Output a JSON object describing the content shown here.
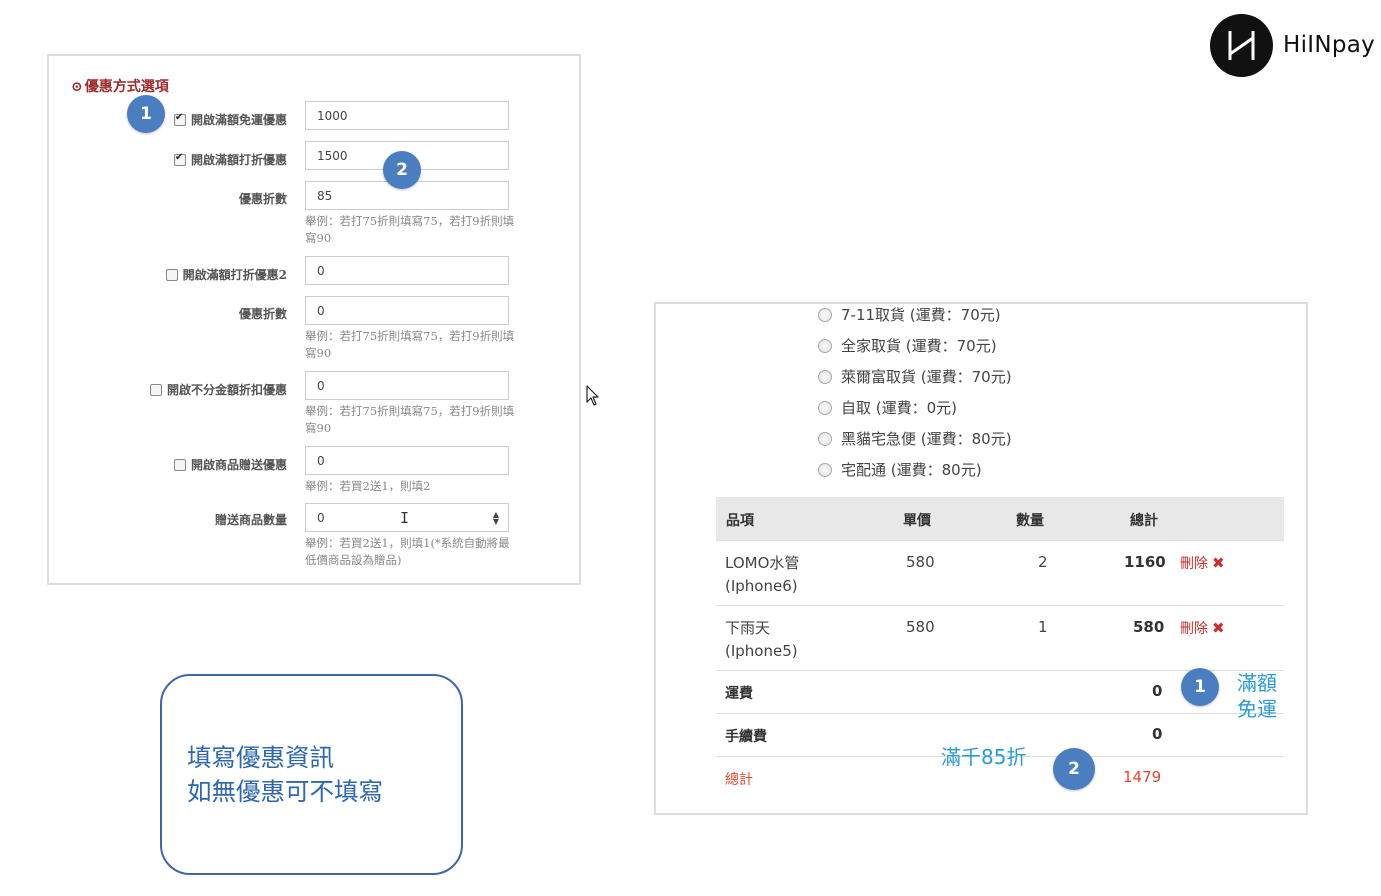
{
  "brand": {
    "name": "HiINpay",
    "logo_icon": "hinpay-logo-icon"
  },
  "settings_panel": {
    "section_title_icon": "target-icon",
    "section_title": "優惠方式選項",
    "rows": {
      "free_shipping": {
        "label": "開啟滿額免運優惠",
        "checked": true,
        "value": "1000"
      },
      "discount1": {
        "label": "開啟滿額打折優惠",
        "checked": true,
        "value": "1500"
      },
      "discount1_rate": {
        "label": "優惠折數",
        "value": "85",
        "hint": "舉例：若打75折則填寫75，若打9折則填寫90"
      },
      "discount2": {
        "label": "開啟滿額打折優惠2",
        "checked": false,
        "value": "0"
      },
      "discount2_rate": {
        "label": "優惠折數",
        "value": "0",
        "hint": "舉例：若打75折則填寫75，若打9折則填寫90"
      },
      "flat_discount": {
        "label": "開啟不分金額折扣優惠",
        "checked": false,
        "value": "0",
        "hint": "舉例：若打75折則填寫75，若打9折則填寫90"
      },
      "gift": {
        "label": "開啟商品贈送優惠",
        "checked": false,
        "value": "0",
        "hint": "舉例：若買2送1，則填2"
      },
      "gift_qty": {
        "label": "贈送商品數量",
        "value": "0",
        "hint": "舉例：若買2送1，則填1(*系統自動將最低價商品設為贈品)"
      }
    }
  },
  "badges": {
    "one": "1",
    "two": "2"
  },
  "note": {
    "line1": "填寫優惠資訊",
    "line2": "如無優惠可不填寫"
  },
  "cart": {
    "shipping_options": [
      "7-11取貨 (運費：70元)",
      "全家取貨 (運費：70元)",
      "萊爾富取貨 (運費：70元)",
      "自取 (運費：0元)",
      "黑貓宅急便 (運費：80元)",
      "宅配通 (運費：80元)"
    ],
    "table": {
      "headers": {
        "item": "品項",
        "price": "單價",
        "qty": "數量",
        "total": "總計"
      },
      "rows": [
        {
          "name_line1": "LOMO水管",
          "name_line2": "(Iphone6)",
          "price": "580",
          "qty": "2",
          "total": "1160",
          "delete": "刪除"
        },
        {
          "name_line1": "下雨天",
          "name_line2": "(Iphone5)",
          "price": "580",
          "qty": "1",
          "total": "580",
          "delete": "刪除"
        }
      ],
      "shipping": {
        "label": "運費",
        "value": "0"
      },
      "fee": {
        "label": "手續費",
        "value": "0"
      },
      "grand_total": {
        "label": "總計",
        "value": "1479"
      }
    },
    "annotations": {
      "free_line1": "滿額",
      "free_line2": "免運",
      "discount": "滿千85折"
    }
  },
  "colors": {
    "badge": "#4a7ec1",
    "note_border": "#3e67a8",
    "annotation": "#2b9ad6",
    "danger": "#c9302c",
    "title_red": "#a02b2b"
  }
}
